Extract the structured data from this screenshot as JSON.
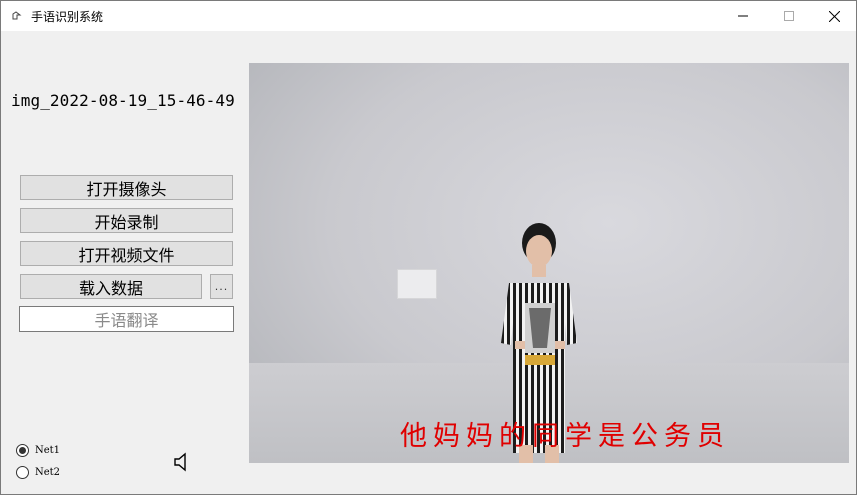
{
  "window": {
    "title": "手语识别系统",
    "icon": "hand-gesture-icon"
  },
  "left_panel": {
    "filename": "img_2022-08-19_15-46-49",
    "buttons": {
      "open_camera": "打开摄像头",
      "start_record": "开始录制",
      "open_video": "打开视频文件",
      "load_data": "载入数据",
      "browse": "...",
      "translate": "手语翻译"
    },
    "models": [
      {
        "label": "Net1",
        "checked": true
      },
      {
        "label": "Net2",
        "checked": false
      }
    ],
    "speaker_icon": "speaker-icon"
  },
  "video": {
    "subtitle": "他妈妈的同学是公务员"
  },
  "colors": {
    "subtitle": "#e00000",
    "panel_bg": "#f0f0f0",
    "button_bg": "#e1e1e1"
  }
}
